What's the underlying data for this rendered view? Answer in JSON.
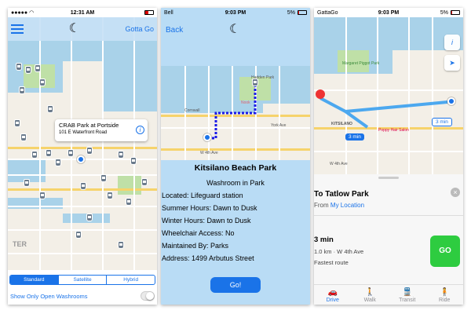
{
  "colors": {
    "accent": "#1a73e8",
    "map_water": "#a9d2e9",
    "go_green": "#2ecc40",
    "panel_bg": "#b9dcf5"
  },
  "phone1": {
    "status": {
      "carrier": "",
      "time": "12:31 AM",
      "battery_icon": "battery-icon"
    },
    "nav": {
      "menu_icon": "hamburger-icon",
      "logo": "☾",
      "right_link": "Gotta Go"
    },
    "callout": {
      "title": "CRAB Park at Portside",
      "subtitle": "101 E Waterfront Road"
    },
    "map_labels": {
      "district": "TER"
    },
    "segments": [
      "Standard",
      "Satellite",
      "Hybrid"
    ],
    "selected_segment": "Standard",
    "toggle_label": "Show Only Open Washrooms",
    "toggle_on": false
  },
  "phone2": {
    "status": {
      "carrier": "Bell",
      "time": "9:03 PM",
      "battery": "5%"
    },
    "nav": {
      "back": "Back",
      "logo": "☾"
    },
    "map_labels": {
      "park": "Hadden Park",
      "cornwall": "Cornwall",
      "york": "York Ave",
      "w4th": "W 4th Ave",
      "nook": "Nook"
    },
    "detail": {
      "title": "Kitsilano Beach Park",
      "subtitle": "Washroom in Park",
      "rows": [
        "Located: Lifeguard station",
        "Summer Hours: Dawn to Dusk",
        "Winter Hours: Dawn to Dusk",
        "Wheelchair Access: No",
        "Maintained By: Parks",
        "Address: 1499 Arbutus Street"
      ],
      "go_label": "Go!"
    }
  },
  "phone3": {
    "status": {
      "carrier": "GattaGo",
      "time": "9:03 PM",
      "battery": "5%"
    },
    "map_labels": {
      "park": "Margaret Piggot Park",
      "kits": "KITSILANO",
      "salon": "Poppy Hair Salon",
      "w4th": "W 4th Ave",
      "eta1": "3 min",
      "eta2": "3 min"
    },
    "sheet": {
      "title": "To Tatlow Park",
      "from_prefix": "From",
      "from_link": "My Location",
      "time": "3 min",
      "distance": "1.0 km · W 4th Ave",
      "route": "Fastest route",
      "go": "GO"
    },
    "tabs": [
      {
        "label": "Drive",
        "icon": "car-icon",
        "glyph": "🚗",
        "selected": true
      },
      {
        "label": "Walk",
        "icon": "walk-icon",
        "glyph": "🚶",
        "selected": false
      },
      {
        "label": "Transit",
        "icon": "train-icon",
        "glyph": "🚆",
        "selected": false
      },
      {
        "label": "Ride",
        "icon": "ride-icon",
        "glyph": "🧍",
        "selected": false
      }
    ]
  }
}
